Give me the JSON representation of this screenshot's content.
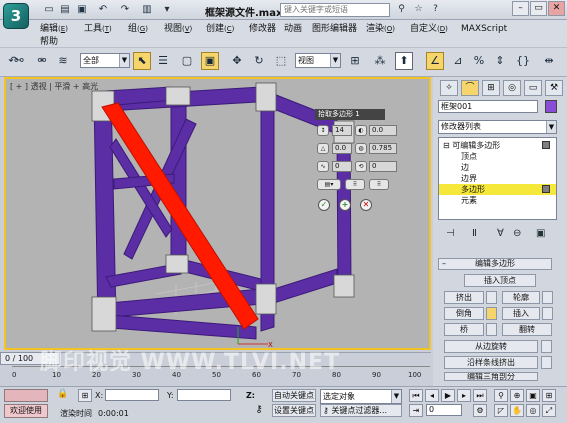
{
  "app": {
    "title": "框架源文件.max",
    "search_placeholder": "键入关键字或短语",
    "logo_text": "3"
  },
  "menubar": {
    "items": [
      "编辑",
      "工具",
      "组",
      "视图",
      "创建",
      "修改器",
      "动画",
      "图形编辑器",
      "渲染",
      "自定义",
      "MAXScript",
      "帮助"
    ],
    "marks": [
      "E",
      "T",
      "G",
      "V",
      "C",
      "O",
      "D"
    ]
  },
  "toolbar": {
    "filter_value": "全部",
    "refcoord_value": "视图"
  },
  "viewport": {
    "label": "[ + ] 透视 | 平滑 + 高光"
  },
  "caddy": {
    "title": "拾取多边形 1",
    "fields": [
      "14",
      "0.0",
      "0.0",
      "0.785",
      "0",
      "0"
    ]
  },
  "command_panel": {
    "object_name": "框架001",
    "modifier_list": "修改器列表",
    "stack": [
      {
        "label": "可编辑多边形",
        "highlight": false
      },
      {
        "label": "顶点",
        "highlight": false
      },
      {
        "label": "边",
        "highlight": false
      },
      {
        "label": "边界",
        "highlight": false
      },
      {
        "label": "多边形",
        "highlight": true
      },
      {
        "label": "元素",
        "highlight": false
      }
    ],
    "rollout_title": "编辑多边形",
    "insert_vertex": "插入顶点",
    "buttons": [
      "挤出",
      "轮廓",
      "倒角",
      "插入",
      "桥",
      "翻转"
    ],
    "hinge": "从边旋转",
    "extrude_spline": "沿样条线挤出",
    "edit_triangulation": "编辑三角剖分"
  },
  "timeline": {
    "slider_text": "0 / 100",
    "ticks": [
      "0",
      "10",
      "20",
      "30",
      "40",
      "50",
      "60",
      "70",
      "80",
      "90",
      "100"
    ]
  },
  "statusbar": {
    "welcome": "欢迎使用",
    "x_label": "X:",
    "y_label": "Y:",
    "z_label": "Z:",
    "render_time_label": "渲染时间",
    "render_time": "0:00:01",
    "autokey": "自动关键点",
    "setkey": "设置关键点",
    "selected_object": "选定对象",
    "key_filters": "关键点过滤器...",
    "frame_value": "0"
  },
  "watermark": "脚印视觉 WWW.TLVI.NET",
  "colors": {
    "viewport_border": "#f2c423",
    "frame_purple": "#5b2ea6",
    "diagonal_red": "#ff1a00",
    "highlight": "#f5e83a"
  }
}
